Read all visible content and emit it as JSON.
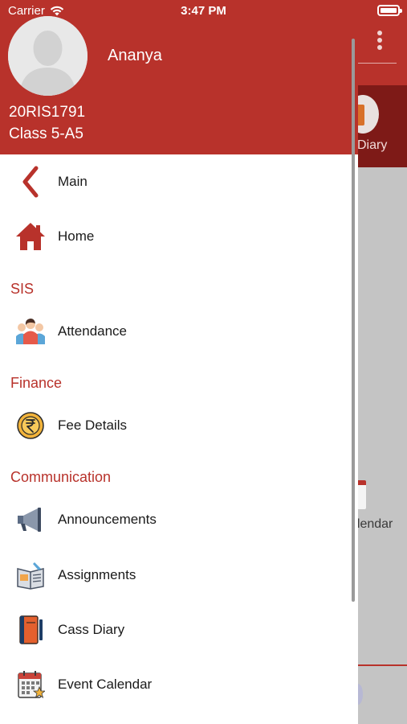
{
  "status_bar": {
    "carrier": "Carrier",
    "time": "3:47 PM"
  },
  "profile": {
    "name": "Ananya",
    "id": "20RIS1791",
    "class": "Class 5-A5"
  },
  "menu": {
    "main_label": "Main",
    "home_label": "Home",
    "sections": [
      {
        "title": "SIS",
        "items": [
          {
            "label": "Attendance",
            "icon": "attendance-icon"
          }
        ]
      },
      {
        "title": "Finance",
        "items": [
          {
            "label": "Fee Details",
            "icon": "rupee-coin-icon"
          }
        ]
      },
      {
        "title": "Communication",
        "items": [
          {
            "label": "Announcements",
            "icon": "megaphone-icon"
          },
          {
            "label": "Assignments",
            "icon": "assignment-icon"
          },
          {
            "label": "Cass Diary",
            "icon": "diary-icon"
          },
          {
            "label": "Event Calendar",
            "icon": "calendar-icon"
          }
        ]
      }
    ]
  },
  "background_screen": {
    "tile_1": "Diary",
    "tile_2": "alendar"
  },
  "colors": {
    "brand": "#b8322b",
    "brand_dark": "#7e1a17",
    "overlay": "#c4c4c4"
  }
}
